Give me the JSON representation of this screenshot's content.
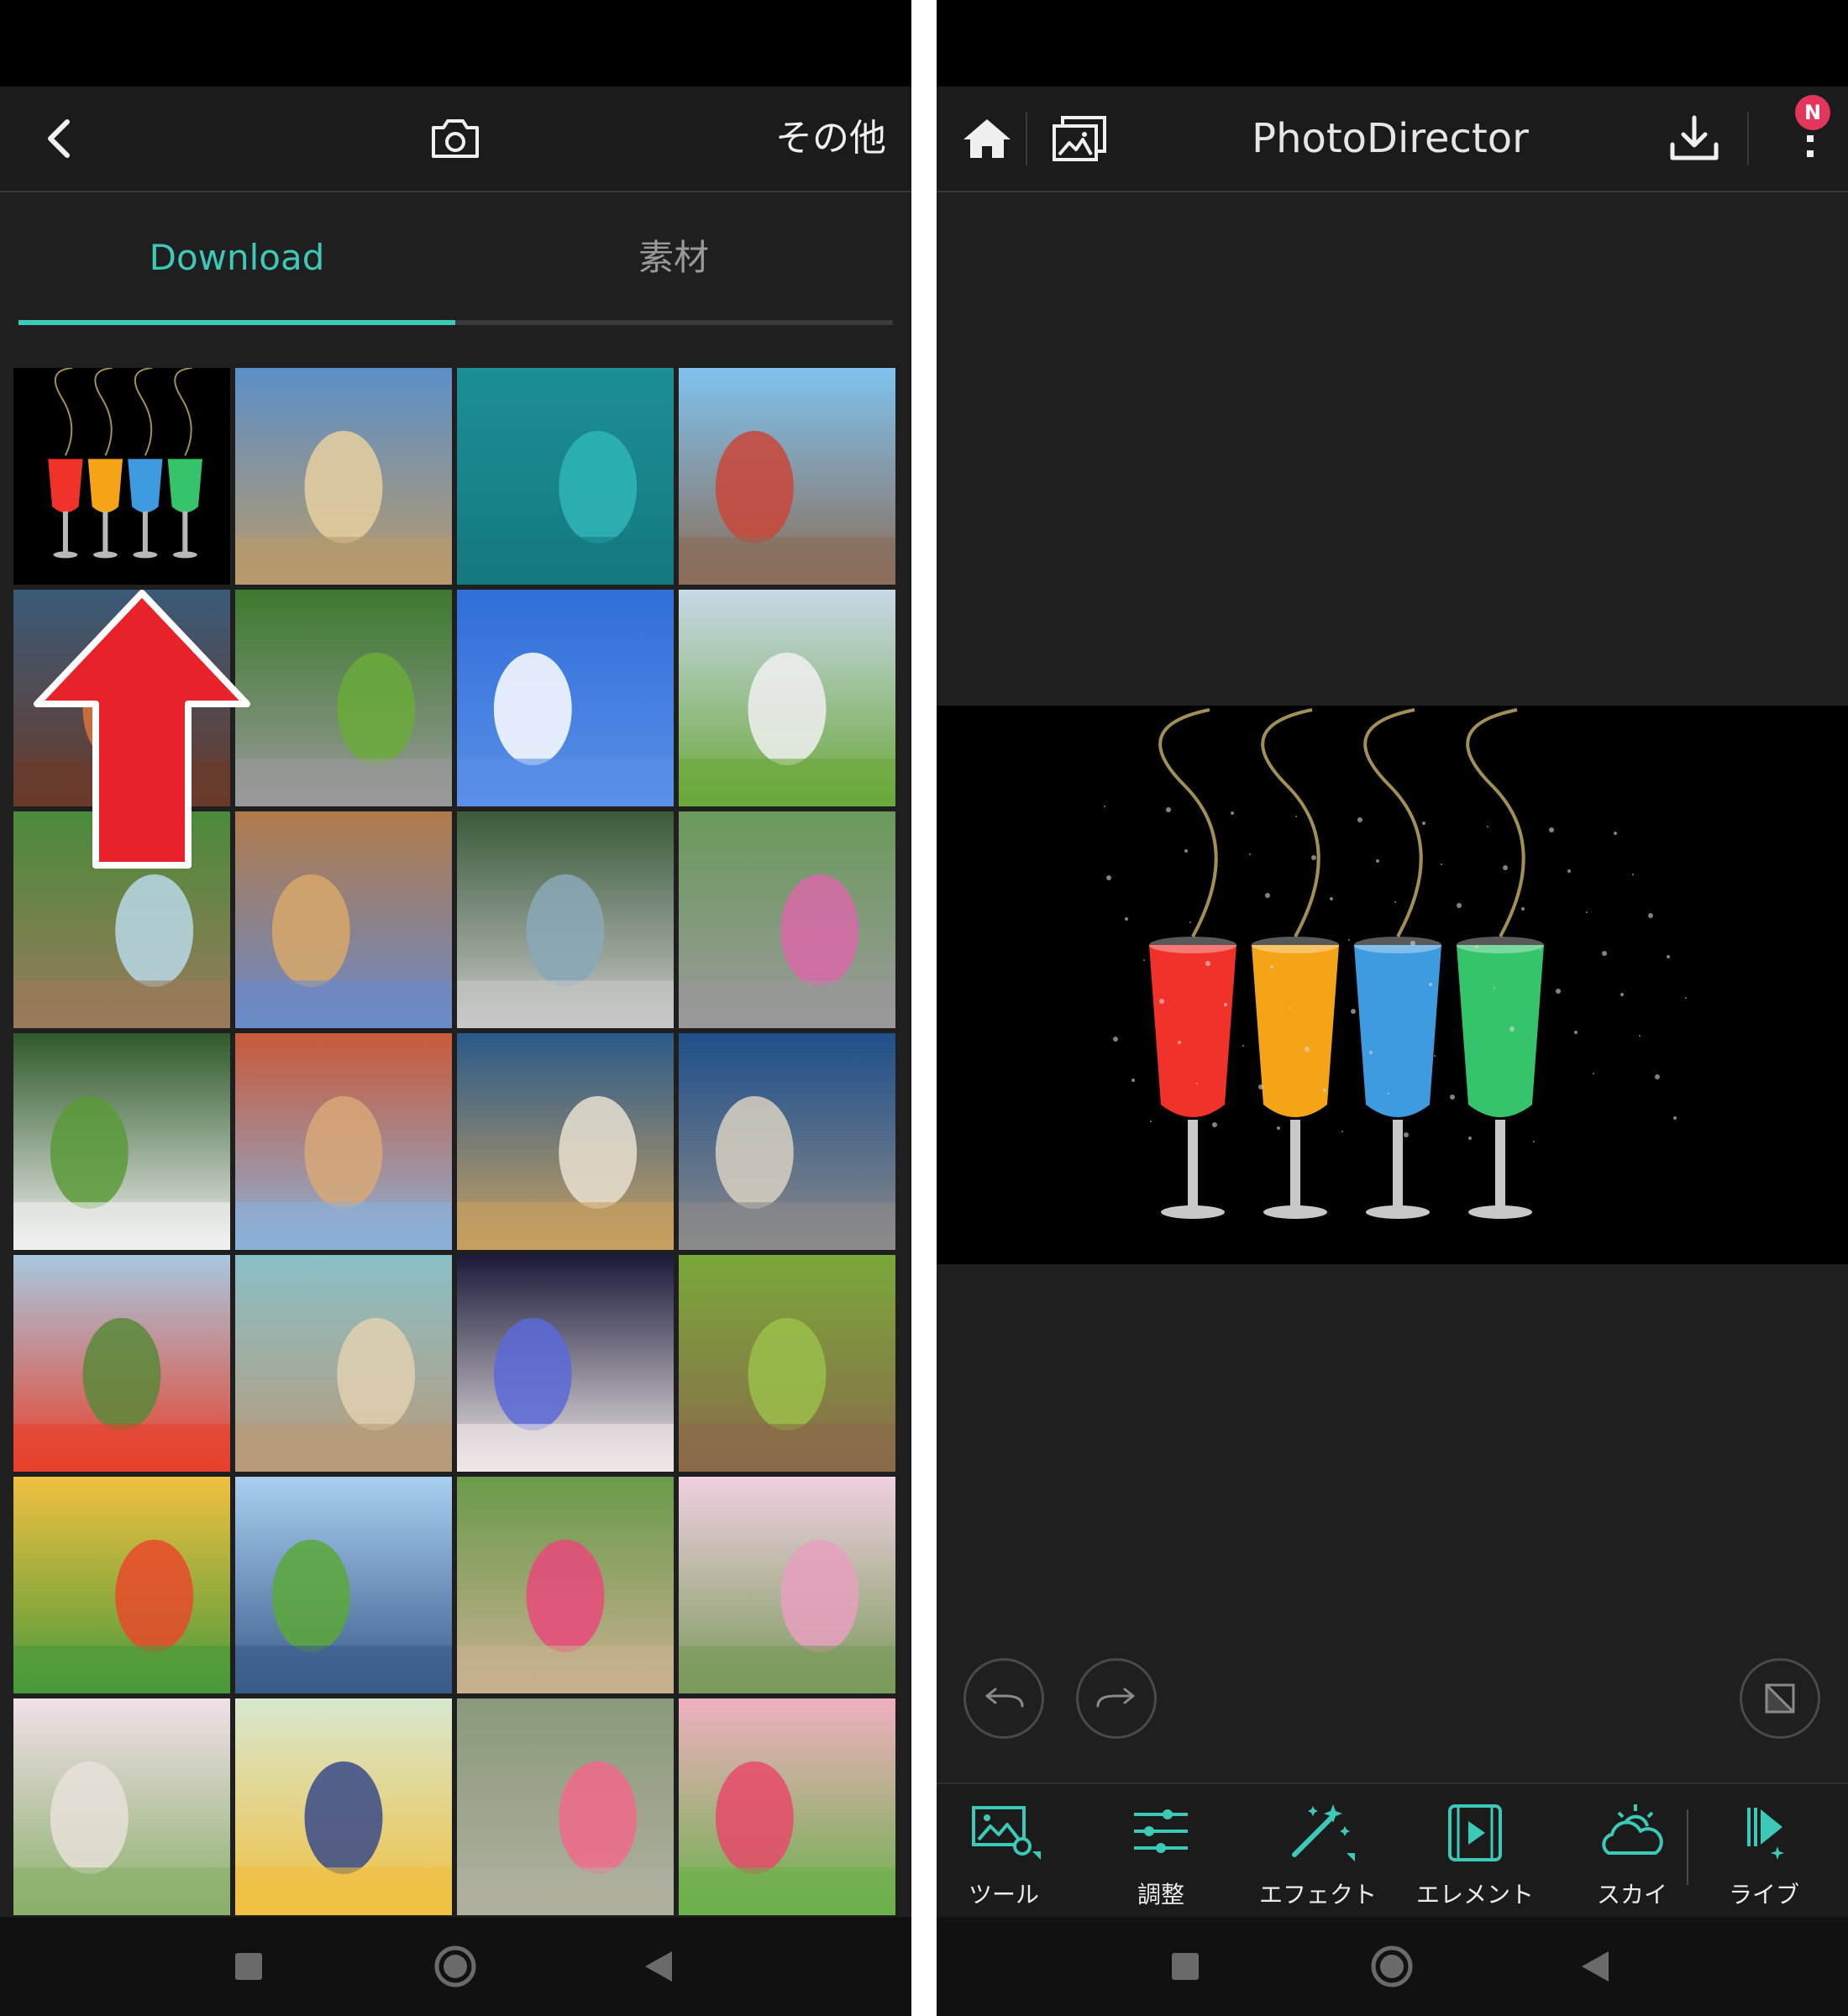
{
  "left": {
    "header": {
      "more_label": "その他"
    },
    "tabs": [
      {
        "label": "Download",
        "active": true
      },
      {
        "label": "素材",
        "active": false
      }
    ],
    "grid": {
      "rows": 7,
      "cols": 4,
      "photos": [
        "cocktail-glasses",
        "beach-handstand",
        "ocean-surfer",
        "train-station-backpacker",
        "coral-reef",
        "boy-on-bicycle",
        "blue-sky-clouds",
        "girl-with-camera",
        "girl-at-fountain",
        "stone-alley",
        "woman-at-river",
        "boy-with-net",
        "toddler-kicking-ball",
        "old-town-tower",
        "harbor-ferry",
        "rocky-coast",
        "poppy-flowers",
        "beach-jump",
        "birthday-cake",
        "rabbit-in-grass",
        "butterfly-flowers",
        "girl-on-swing",
        "boy-in-garden",
        "woman-in-cosmos",
        "laughing-baby",
        "toddler-in-vest",
        "girl-with-flower-crown",
        "girl-with-clover"
      ]
    },
    "overlay": {
      "icon": "red-up-arrow-icon"
    }
  },
  "right": {
    "header": {
      "title": "PhotoDirector",
      "badge": "N"
    },
    "canvas": {
      "photo": "cocktail-glasses"
    },
    "toolbar": {
      "items": [
        {
          "label": "ツール",
          "icon": "tools-icon"
        },
        {
          "label": "調整",
          "icon": "sliders-icon"
        },
        {
          "label": "エフェクト",
          "icon": "magic-wand-icon"
        },
        {
          "label": "エレメント",
          "icon": "element-play-icon"
        },
        {
          "label": "スカイ",
          "icon": "sky-icon"
        },
        {
          "label": "ライブ",
          "icon": "live-play-icon"
        }
      ]
    }
  },
  "colors": {
    "accent": "#3dc9b8",
    "badge": "#e2365c",
    "arrow": "#e8222a",
    "background": "#1f1f1f"
  }
}
